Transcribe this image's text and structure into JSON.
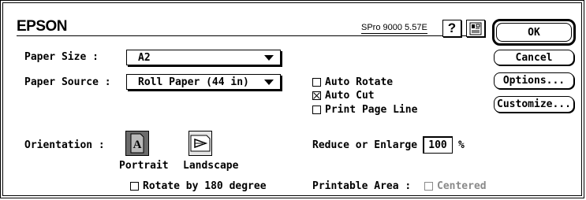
{
  "header": {
    "brand": "EPSON",
    "version": "SPro 9000 5.57E",
    "help_icon": "question-mark-icon",
    "utility_icon": "printer-utility-icon"
  },
  "buttons": {
    "ok": "OK",
    "cancel": "Cancel",
    "options": "Options...",
    "customize": "Customize..."
  },
  "paper_size": {
    "label": "Paper Size :",
    "value": "A2"
  },
  "paper_source": {
    "label": "Paper Source :",
    "value": "Roll Paper (44 in)"
  },
  "checkboxes": {
    "auto_rotate": {
      "label": "Auto Rotate",
      "checked": false
    },
    "auto_cut": {
      "label": "Auto Cut",
      "checked": true
    },
    "print_page_line": {
      "label": "Print Page Line",
      "checked": false
    }
  },
  "orientation": {
    "label": "Orientation :",
    "portrait": "Portrait",
    "landscape": "Landscape",
    "selected": "portrait",
    "rotate_180": {
      "label": "Rotate by 180 degree",
      "checked": false
    }
  },
  "reduce_enlarge": {
    "label": "Reduce or Enlarge",
    "value": "100",
    "unit": "%"
  },
  "printable_area": {
    "label": "Printable Area :",
    "centered": {
      "label": "Centered",
      "checked": false,
      "enabled": false
    }
  },
  "colors": {
    "ink": "#000000",
    "disabled": "#8a8a8a",
    "selected_icon_bg": "#6b6b6b"
  }
}
